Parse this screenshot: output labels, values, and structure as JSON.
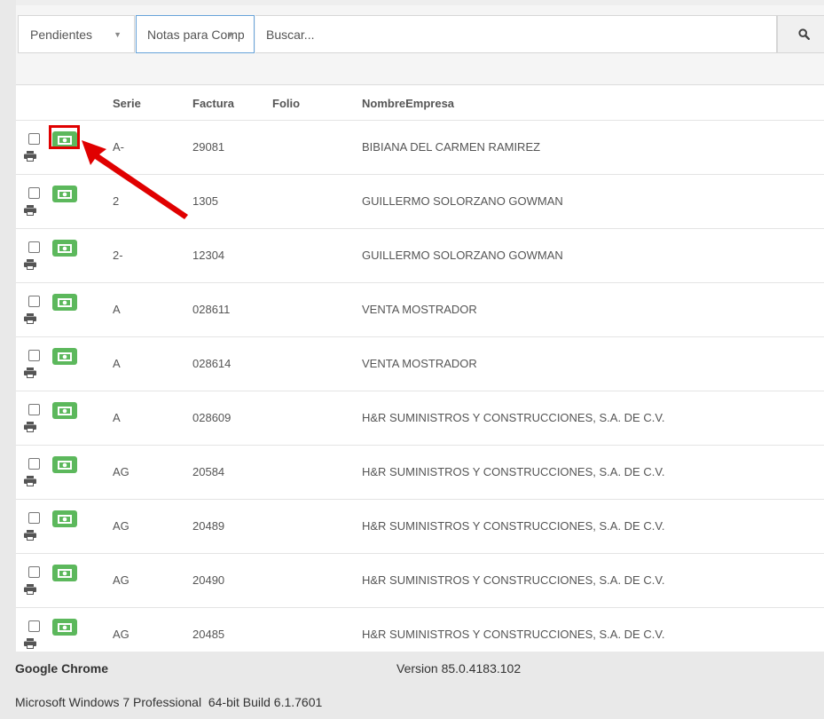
{
  "filters": {
    "status_value": "Pendientes",
    "type_value": "Notas para Comp",
    "search_placeholder": "Buscar..."
  },
  "table": {
    "headers": {
      "serie": "Serie",
      "factura": "Factura",
      "folio": "Folio",
      "empresa": "NombreEmpresa"
    },
    "rows": [
      {
        "serie": "A-",
        "factura": "29081",
        "folio": "",
        "empresa": "BIBIANA DEL CARMEN RAMIREZ"
      },
      {
        "serie": "2",
        "factura": "1305",
        "folio": "",
        "empresa": "GUILLERMO SOLORZANO GOWMAN"
      },
      {
        "serie": "2-",
        "factura": "12304",
        "folio": "",
        "empresa": "GUILLERMO SOLORZANO GOWMAN"
      },
      {
        "serie": "A",
        "factura": "028611",
        "folio": "",
        "empresa": "VENTA MOSTRADOR"
      },
      {
        "serie": "A",
        "factura": "028614",
        "folio": "",
        "empresa": "VENTA MOSTRADOR"
      },
      {
        "serie": "A",
        "factura": "028609",
        "folio": "",
        "empresa": "H&R SUMINISTROS Y CONSTRUCCIONES, S.A. DE C.V."
      },
      {
        "serie": "AG",
        "factura": "20584",
        "folio": "",
        "empresa": "H&R SUMINISTROS Y CONSTRUCCIONES, S.A. DE C.V."
      },
      {
        "serie": "AG",
        "factura": "20489",
        "folio": "",
        "empresa": "H&R SUMINISTROS Y CONSTRUCCIONES, S.A. DE C.V."
      },
      {
        "serie": "AG",
        "factura": "20490",
        "folio": "",
        "empresa": "H&R SUMINISTROS Y CONSTRUCCIONES, S.A. DE C.V."
      },
      {
        "serie": "AG",
        "factura": "20485",
        "folio": "",
        "empresa": "H&R SUMINISTROS Y CONSTRUCCIONES, S.A. DE C.V."
      }
    ]
  },
  "footer": {
    "browser": "Google Chrome",
    "version": "Version 85.0.4183.102",
    "os": "Microsoft Windows 7 Professional  64-bit Build 6.1.7601"
  },
  "colors": {
    "money_button": "#5cb85c",
    "highlight": "#e00000",
    "focus_border": "#66a3d9"
  },
  "icons": {
    "money": "money-icon",
    "print": "print-icon",
    "search": "search-icon",
    "caret": "caret-down-icon"
  }
}
